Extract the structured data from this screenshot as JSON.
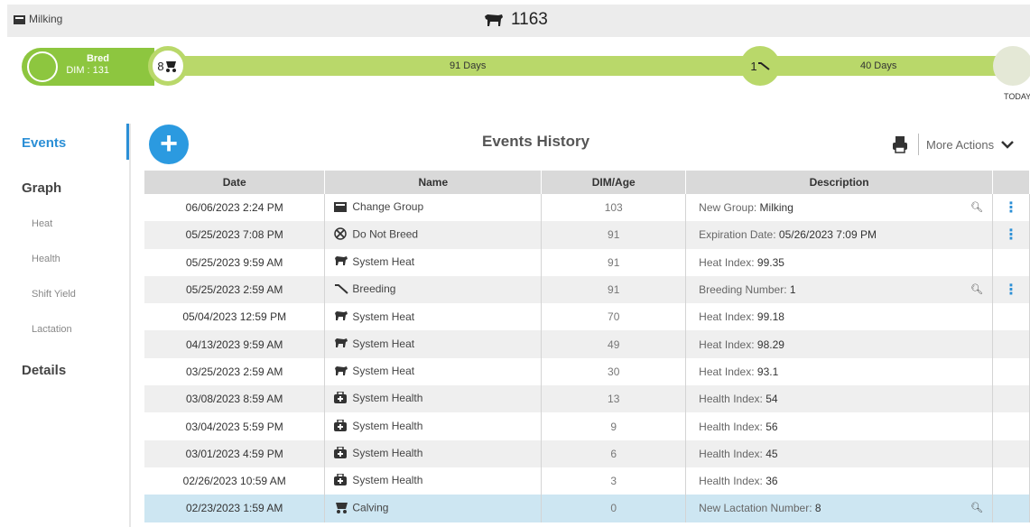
{
  "header": {
    "group": "Milking",
    "cow_number": "1163"
  },
  "timeline": {
    "status": "Bred",
    "dim": "DIM : 131",
    "calving_lactation": "8",
    "breeding_number": "1",
    "days_since_calving": "91 Days",
    "days_since_breeding": "40 Days",
    "today_label": "TODAY",
    "accent_color": "#8dc63f"
  },
  "sidebar": {
    "events": "Events",
    "graph": "Graph",
    "heat": "Heat",
    "health": "Health",
    "shift_yield": "Shift Yield",
    "lactation": "Lactation",
    "details": "Details"
  },
  "main": {
    "title": "Events History",
    "more_actions": "More Actions",
    "columns": [
      "Date",
      "Name",
      "DIM/Age",
      "Description"
    ],
    "rows": [
      {
        "date": "06/06/2023 2:24 PM",
        "icon": "change-group-icon",
        "name": "Change Group",
        "dim": "103",
        "label": "New Group:",
        "value": "Milking",
        "zoom": true,
        "menu": true
      },
      {
        "date": "05/25/2023 7:08 PM",
        "icon": "do-not-breed-icon",
        "name": "Do Not Breed",
        "dim": "91",
        "label": "Expiration Date:",
        "value": "05/26/2023 7:09 PM",
        "zoom": false,
        "menu": true
      },
      {
        "date": "05/25/2023 9:59 AM",
        "icon": "system-heat-icon",
        "name": "System Heat",
        "dim": "91",
        "label": "Heat Index:",
        "value": "99.35",
        "zoom": false,
        "menu": false
      },
      {
        "date": "05/25/2023 2:59 AM",
        "icon": "breeding-icon",
        "name": "Breeding",
        "dim": "91",
        "label": "Breeding Number:",
        "value": "1",
        "zoom": true,
        "menu": true
      },
      {
        "date": "05/04/2023 12:59 PM",
        "icon": "system-heat-icon",
        "name": "System Heat",
        "dim": "70",
        "label": "Heat Index:",
        "value": "99.18",
        "zoom": false,
        "menu": false
      },
      {
        "date": "04/13/2023 9:59 AM",
        "icon": "system-heat-icon",
        "name": "System Heat",
        "dim": "49",
        "label": "Heat Index:",
        "value": "98.29",
        "zoom": false,
        "menu": false
      },
      {
        "date": "03/25/2023 2:59 AM",
        "icon": "system-heat-icon",
        "name": "System Heat",
        "dim": "30",
        "label": "Heat Index:",
        "value": "93.1",
        "zoom": false,
        "menu": false
      },
      {
        "date": "03/08/2023 8:59 AM",
        "icon": "system-health-icon",
        "name": "System Health",
        "dim": "13",
        "label": "Health Index:",
        "value": "54",
        "zoom": false,
        "menu": false
      },
      {
        "date": "03/04/2023 5:59 PM",
        "icon": "system-health-icon",
        "name": "System Health",
        "dim": "9",
        "label": "Health Index:",
        "value": "56",
        "zoom": false,
        "menu": false
      },
      {
        "date": "03/01/2023 4:59 PM",
        "icon": "system-health-icon",
        "name": "System Health",
        "dim": "6",
        "label": "Health Index:",
        "value": "45",
        "zoom": false,
        "menu": false
      },
      {
        "date": "02/26/2023 10:59 AM",
        "icon": "system-health-icon",
        "name": "System Health",
        "dim": "3",
        "label": "Health Index:",
        "value": "36",
        "zoom": false,
        "menu": false
      },
      {
        "date": "02/23/2023 1:59 AM",
        "icon": "calving-icon",
        "name": "Calving",
        "dim": "0",
        "label": "New Lactation Number:",
        "value": "8",
        "zoom": true,
        "menu": false,
        "selected": true
      }
    ]
  }
}
